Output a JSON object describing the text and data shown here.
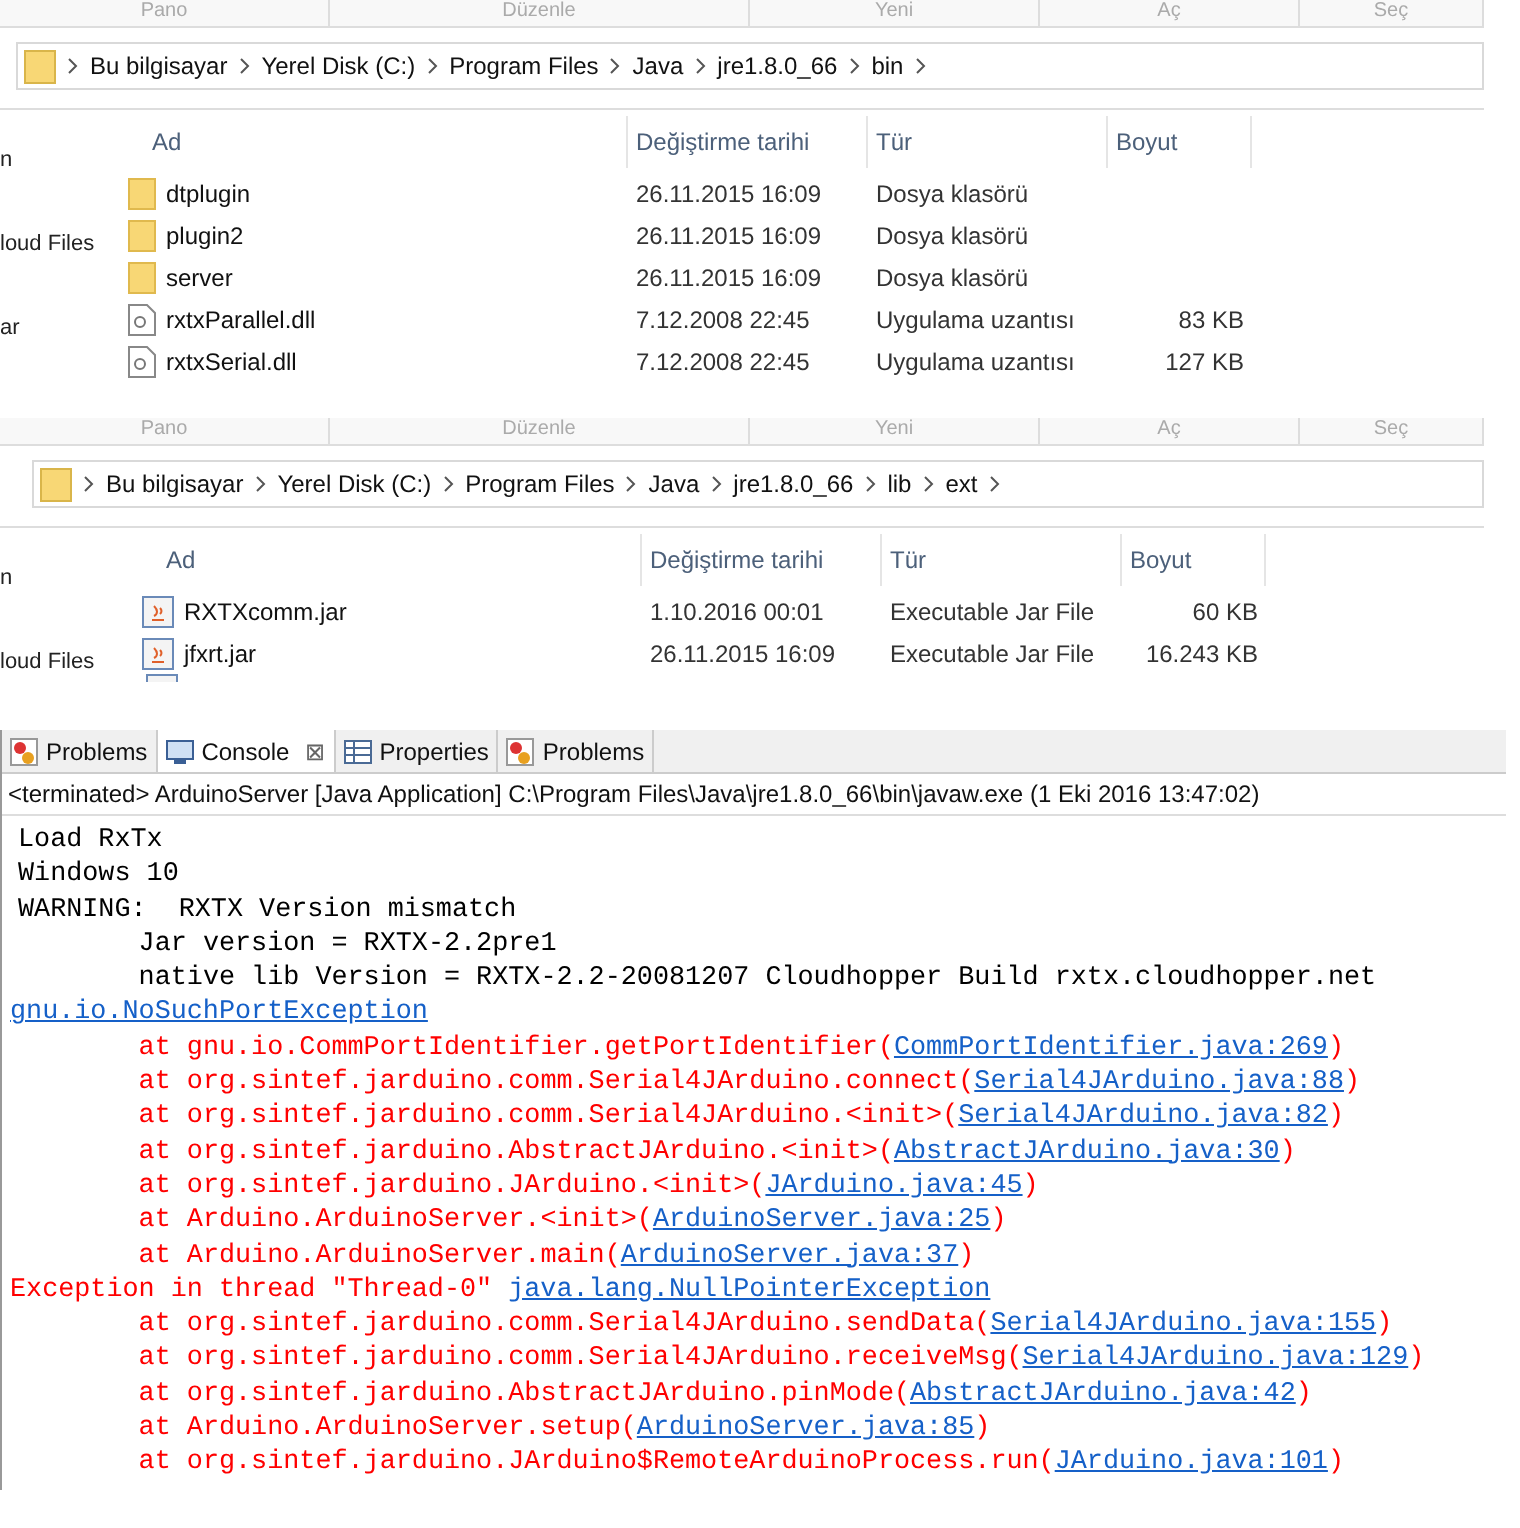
{
  "explorers": [
    {
      "ribbon": [
        "Pano",
        "Düzenle",
        "Yeni",
        "Aç",
        "Seç"
      ],
      "breadcrumb": [
        "Bu bilgisayar",
        "Yerel Disk (C:)",
        "Program Files",
        "Java",
        "jre1.8.0_66",
        "bin"
      ],
      "nav": [
        "n",
        "loud Files",
        "ar"
      ],
      "columns": [
        "Ad",
        "Değiştirme tarihi",
        "Tür",
        "Boyut"
      ],
      "rows": [
        {
          "kind": "folder",
          "name": "dtplugin",
          "date": "26.11.2015 16:09",
          "type": "Dosya klasörü",
          "size": ""
        },
        {
          "kind": "folder",
          "name": "plugin2",
          "date": "26.11.2015 16:09",
          "type": "Dosya klasörü",
          "size": ""
        },
        {
          "kind": "folder",
          "name": "server",
          "date": "26.11.2015 16:09",
          "type": "Dosya klasörü",
          "size": ""
        },
        {
          "kind": "dll",
          "name": "rxtxParallel.dll",
          "date": "7.12.2008 22:45",
          "type": "Uygulama uzantısı",
          "size": "83 KB"
        },
        {
          "kind": "dll",
          "name": "rxtxSerial.dll",
          "date": "7.12.2008 22:45",
          "type": "Uygulama uzantısı",
          "size": "127 KB"
        }
      ],
      "cut_row": false
    },
    {
      "ribbon": [
        "Pano",
        "Düzenle",
        "Yeni",
        "Aç",
        "Seç"
      ],
      "breadcrumb": [
        "Bu bilgisayar",
        "Yerel Disk (C:)",
        "Program Files",
        "Java",
        "jre1.8.0_66",
        "lib",
        "ext"
      ],
      "nav": [
        "n",
        "loud Files"
      ],
      "columns": [
        "Ad",
        "Değiştirme tarihi",
        "Tür",
        "Boyut"
      ],
      "rows": [
        {
          "kind": "jar",
          "name": "RXTXcomm.jar",
          "date": "1.10.2016 00:01",
          "type": "Executable Jar File",
          "size": "60 KB"
        },
        {
          "kind": "jar",
          "name": "jfxrt.jar",
          "date": "26.11.2015 16:09",
          "type": "Executable Jar File",
          "size": "16.243 KB"
        }
      ],
      "cut_row": true
    }
  ],
  "console": {
    "tabs": [
      {
        "kind": "problems",
        "label": "Problems",
        "selected": false
      },
      {
        "kind": "console",
        "label": "Console",
        "selected": true,
        "close": "⊠"
      },
      {
        "kind": "properties",
        "label": "Properties",
        "selected": false
      },
      {
        "kind": "problems",
        "label": "Problems",
        "selected": false
      }
    ],
    "header": "<terminated> ArduinoServer [Java Application] C:\\Program Files\\Java\\jre1.8.0_66\\bin\\javaw.exe (1 Eki 2016 13:47:02)",
    "lines": [
      [
        {
          "kind": "out",
          "text": "Load RxTx"
        }
      ],
      [
        {
          "kind": "out",
          "text": "Windows 10"
        }
      ],
      [
        {
          "kind": "out",
          "text": "WARNING:  RXTX Version mismatch"
        }
      ],
      [
        {
          "kind": "out",
          "text": "\tJar version = RXTX-2.2pre1"
        }
      ],
      [
        {
          "kind": "out",
          "text": "\tnative lib Version = RXTX-2.2-20081207 Cloudhopper Build rxtx.cloudhopper.net"
        }
      ],
      [
        {
          "kind": "link",
          "text": "gnu.io.NoSuchPortException"
        }
      ],
      [
        {
          "kind": "err",
          "text": "\tat gnu.io.CommPortIdentifier.getPortIdentifier("
        },
        {
          "kind": "link",
          "text": "CommPortIdentifier.java:269"
        },
        {
          "kind": "err",
          "text": ")"
        }
      ],
      [
        {
          "kind": "err",
          "text": "\tat org.sintef.jarduino.comm.Serial4JArduino.connect("
        },
        {
          "kind": "link",
          "text": "Serial4JArduino.java:88"
        },
        {
          "kind": "err",
          "text": ")"
        }
      ],
      [
        {
          "kind": "err",
          "text": "\tat org.sintef.jarduino.comm.Serial4JArduino.<init>("
        },
        {
          "kind": "link",
          "text": "Serial4JArduino.java:82"
        },
        {
          "kind": "err",
          "text": ")"
        }
      ],
      [
        {
          "kind": "err",
          "text": "\tat org.sintef.jarduino.AbstractJArduino.<init>("
        },
        {
          "kind": "link",
          "text": "AbstractJArduino.java:30"
        },
        {
          "kind": "err",
          "text": ")"
        }
      ],
      [
        {
          "kind": "err",
          "text": "\tat org.sintef.jarduino.JArduino.<init>("
        },
        {
          "kind": "link",
          "text": "JArduino.java:45"
        },
        {
          "kind": "err",
          "text": ")"
        }
      ],
      [
        {
          "kind": "err",
          "text": "\tat Arduino.ArduinoServer.<init>("
        },
        {
          "kind": "link",
          "text": "ArduinoServer.java:25"
        },
        {
          "kind": "err",
          "text": ")"
        }
      ],
      [
        {
          "kind": "err",
          "text": "\tat Arduino.ArduinoServer.main("
        },
        {
          "kind": "link",
          "text": "ArduinoServer.java:37"
        },
        {
          "kind": "err",
          "text": ")"
        }
      ],
      [
        {
          "kind": "err",
          "text": "Exception in thread \"Thread-0\" "
        },
        {
          "kind": "link",
          "text": "java.lang.NullPointerException"
        }
      ],
      [
        {
          "kind": "err",
          "text": "\tat org.sintef.jarduino.comm.Serial4JArduino.sendData("
        },
        {
          "kind": "link",
          "text": "Serial4JArduino.java:155"
        },
        {
          "kind": "err",
          "text": ")"
        }
      ],
      [
        {
          "kind": "err",
          "text": "\tat org.sintef.jarduino.comm.Serial4JArduino.receiveMsg("
        },
        {
          "kind": "link",
          "text": "Serial4JArduino.java:129"
        },
        {
          "kind": "err",
          "text": ")"
        }
      ],
      [
        {
          "kind": "err",
          "text": "\tat org.sintef.jarduino.AbstractJArduino.pinMode("
        },
        {
          "kind": "link",
          "text": "AbstractJArduino.java:42"
        },
        {
          "kind": "err",
          "text": ")"
        }
      ],
      [
        {
          "kind": "err",
          "text": "\tat Arduino.ArduinoServer.setup("
        },
        {
          "kind": "link",
          "text": "ArduinoServer.java:85"
        },
        {
          "kind": "err",
          "text": ")"
        }
      ],
      [
        {
          "kind": "err",
          "text": "\tat org.sintef.jarduino.JArduino$RemoteArduinoProcess.run("
        },
        {
          "kind": "link",
          "text": "JArduino.java:101"
        },
        {
          "kind": "err",
          "text": ")"
        }
      ]
    ]
  }
}
